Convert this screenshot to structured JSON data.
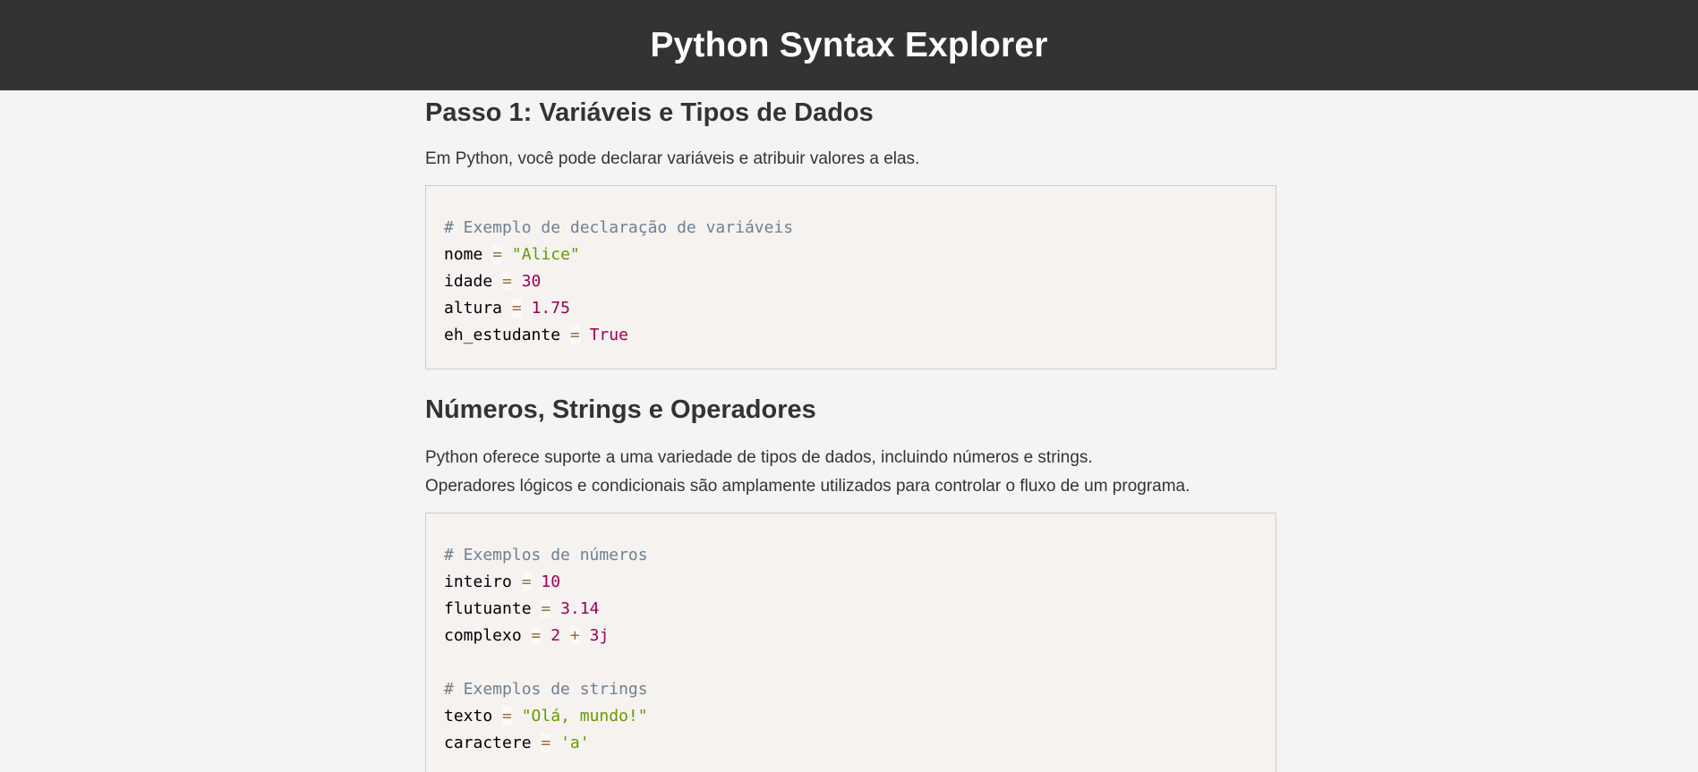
{
  "header": {
    "title": "Python Syntax Explorer"
  },
  "sections": [
    {
      "heading": "Passo 1: Variáveis e Tipos de Dados",
      "paragraphs": [
        "Em Python, você pode declarar variáveis e atribuir valores a elas."
      ],
      "code": [
        [
          {
            "t": "comment",
            "v": "# Exemplo de declaração de variáveis"
          }
        ],
        [
          {
            "t": "name",
            "v": "nome"
          },
          {
            "t": "ws",
            "v": " "
          },
          {
            "t": "op",
            "v": "="
          },
          {
            "t": "ws",
            "v": " "
          },
          {
            "t": "string",
            "v": "\"Alice\""
          }
        ],
        [
          {
            "t": "name",
            "v": "idade"
          },
          {
            "t": "ws",
            "v": " "
          },
          {
            "t": "op",
            "v": "="
          },
          {
            "t": "ws",
            "v": " "
          },
          {
            "t": "number",
            "v": "30"
          }
        ],
        [
          {
            "t": "name",
            "v": "altura"
          },
          {
            "t": "ws",
            "v": " "
          },
          {
            "t": "op",
            "v": "="
          },
          {
            "t": "ws",
            "v": " "
          },
          {
            "t": "number",
            "v": "1.75"
          }
        ],
        [
          {
            "t": "name",
            "v": "eh_estudante"
          },
          {
            "t": "ws",
            "v": " "
          },
          {
            "t": "op",
            "v": "="
          },
          {
            "t": "ws",
            "v": " "
          },
          {
            "t": "bool",
            "v": "True"
          }
        ]
      ]
    },
    {
      "heading": "Números, Strings e Operadores",
      "paragraphs": [
        "Python oferece suporte a uma variedade de tipos de dados, incluindo números e strings.",
        "Operadores lógicos e condicionais são amplamente utilizados para controlar o fluxo de um programa."
      ],
      "code": [
        [
          {
            "t": "comment",
            "v": "# Exemplos de números"
          }
        ],
        [
          {
            "t": "name",
            "v": "inteiro"
          },
          {
            "t": "ws",
            "v": " "
          },
          {
            "t": "op",
            "v": "="
          },
          {
            "t": "ws",
            "v": " "
          },
          {
            "t": "number",
            "v": "10"
          }
        ],
        [
          {
            "t": "name",
            "v": "flutuante"
          },
          {
            "t": "ws",
            "v": " "
          },
          {
            "t": "op",
            "v": "="
          },
          {
            "t": "ws",
            "v": " "
          },
          {
            "t": "number",
            "v": "3.14"
          }
        ],
        [
          {
            "t": "name",
            "v": "complexo"
          },
          {
            "t": "ws",
            "v": " "
          },
          {
            "t": "op",
            "v": "="
          },
          {
            "t": "ws",
            "v": " "
          },
          {
            "t": "number",
            "v": "2"
          },
          {
            "t": "ws",
            "v": " "
          },
          {
            "t": "op",
            "v": "+"
          },
          {
            "t": "ws",
            "v": " "
          },
          {
            "t": "number",
            "v": "3j"
          }
        ],
        [],
        [
          {
            "t": "comment",
            "v": "# Exemplos de strings"
          }
        ],
        [
          {
            "t": "name",
            "v": "texto"
          },
          {
            "t": "ws",
            "v": " "
          },
          {
            "t": "op",
            "v": "="
          },
          {
            "t": "ws",
            "v": " "
          },
          {
            "t": "string",
            "v": "\"Olá, mundo!\""
          }
        ],
        [
          {
            "t": "name",
            "v": "caractere"
          },
          {
            "t": "ws",
            "v": " "
          },
          {
            "t": "op",
            "v": "="
          },
          {
            "t": "ws",
            "v": " "
          },
          {
            "t": "string",
            "v": "'a'"
          }
        ]
      ]
    }
  ]
}
